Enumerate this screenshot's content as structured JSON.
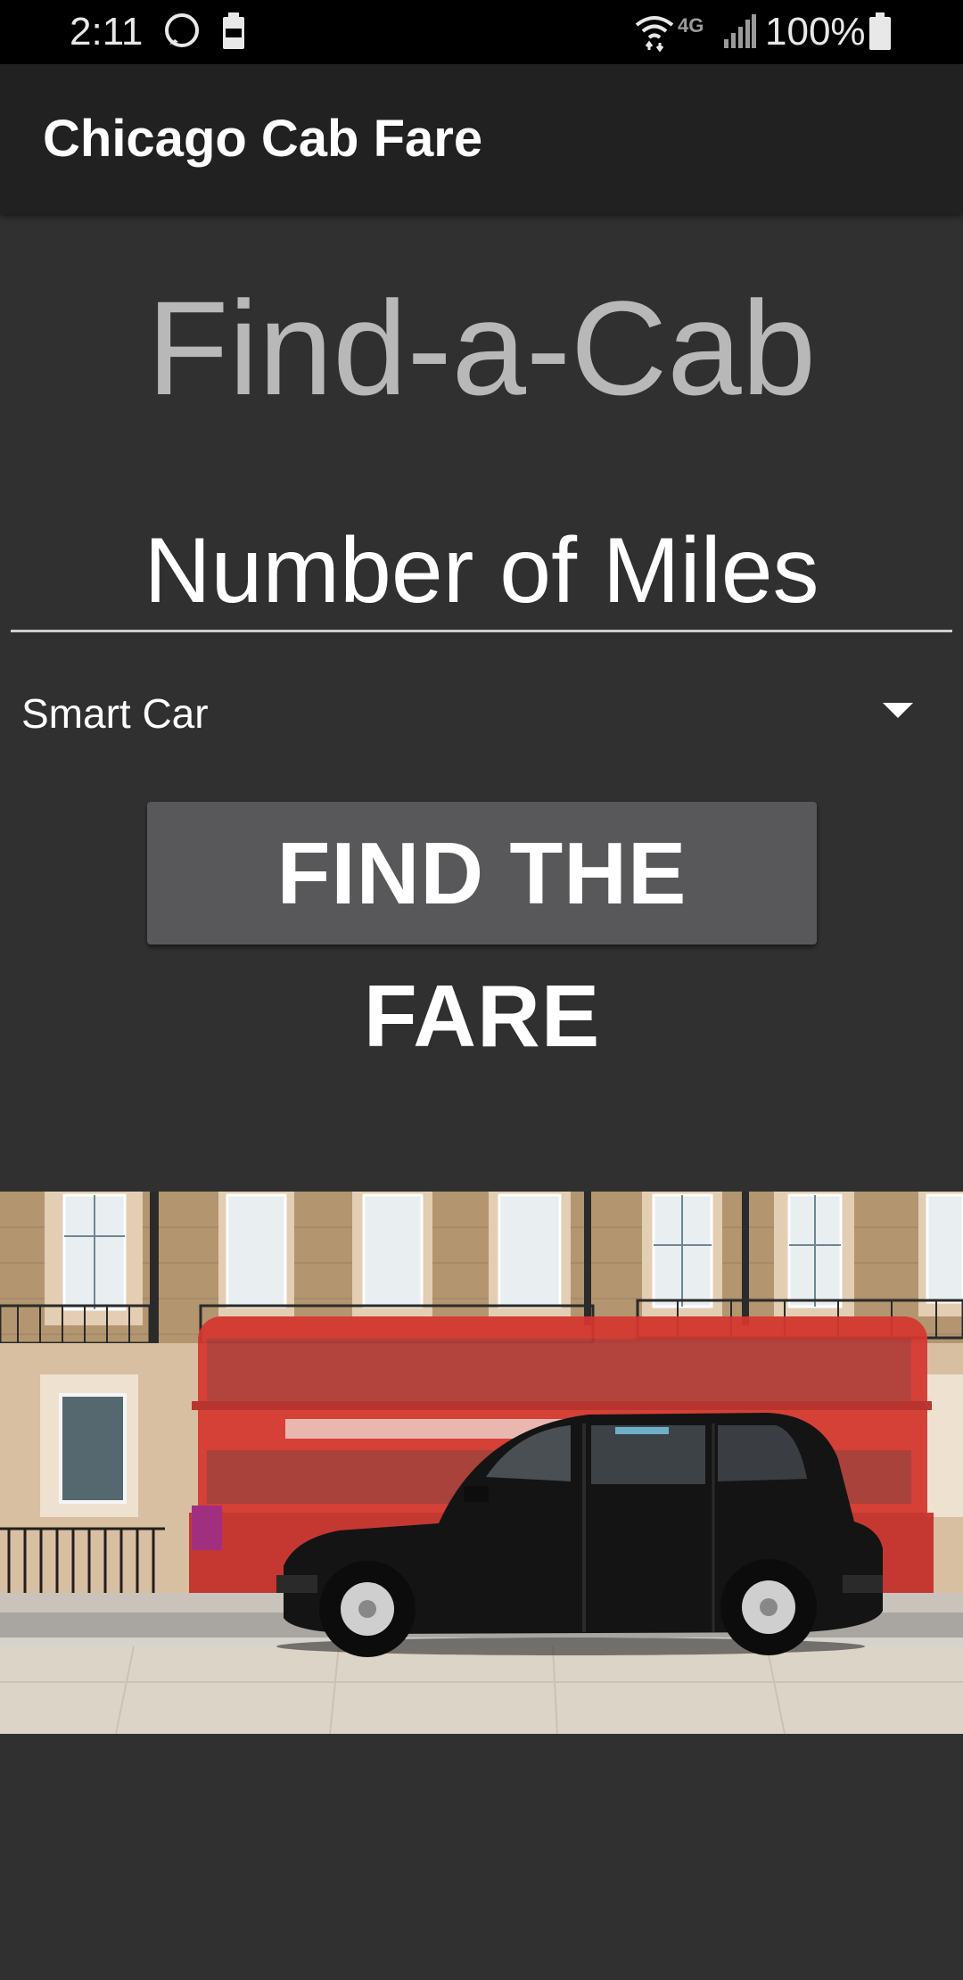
{
  "status_bar": {
    "time": "2:11",
    "network": "4G",
    "battery": "100%",
    "icons": [
      "message-icon",
      "battery-saver-icon",
      "wifi-icon",
      "signal-icon",
      "battery-icon"
    ]
  },
  "app_bar": {
    "title": "Chicago Cab Fare"
  },
  "main": {
    "heading": "Find-a-Cab",
    "miles_placeholder": "Number of Miles",
    "car_type_selected": "Smart Car",
    "find_button_label": "FIND THE FARE"
  },
  "colors": {
    "background": "#303030",
    "app_bar": "#212121",
    "button": "#58585b",
    "heading_text": "#b8b8b8"
  }
}
